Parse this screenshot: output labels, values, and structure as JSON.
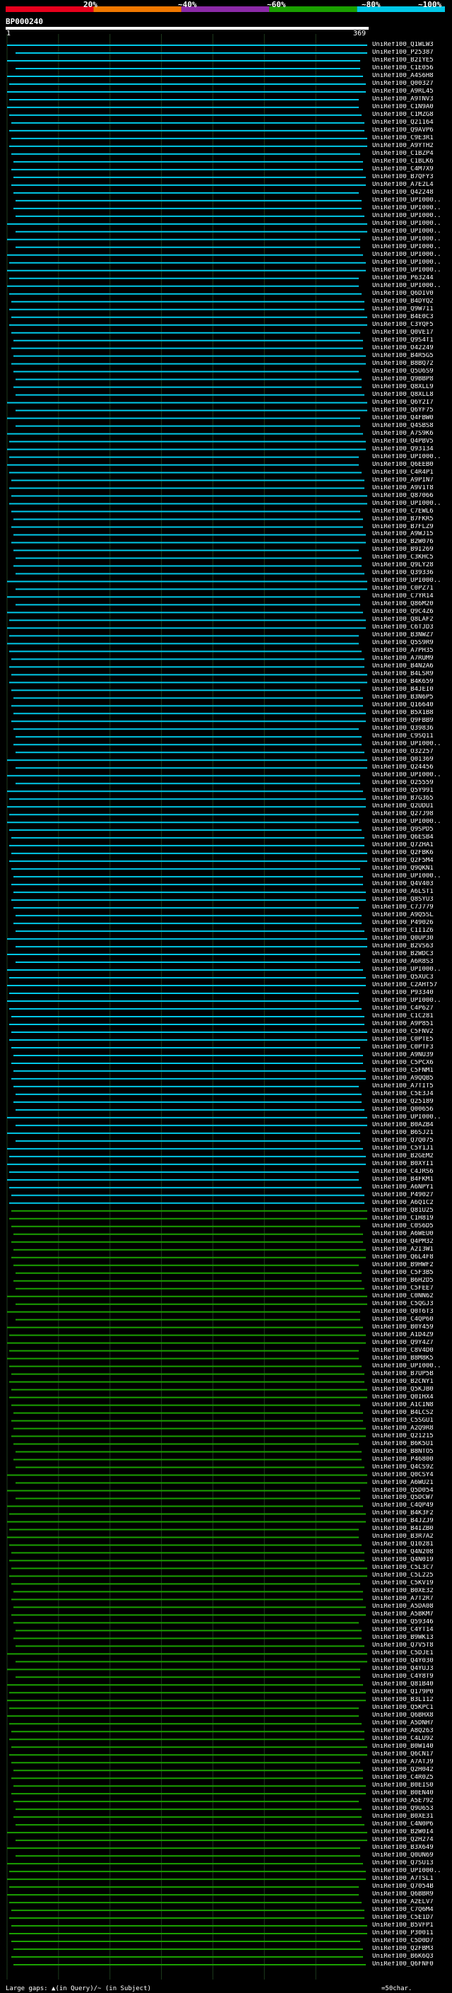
{
  "header": {
    "query_name": "BP000240",
    "ruler_start": "1",
    "ruler_end": "369",
    "color_bands": [
      {
        "label": "20%",
        "color": "#e8001c"
      },
      {
        "label": "40%",
        "color": "#f07800"
      },
      {
        "label": "60%",
        "color": "#8c2aa8"
      },
      {
        "label": "80%",
        "color": "#1aa000"
      },
      {
        "label": "100%",
        "color": "#00c8e8"
      }
    ],
    "band_labels": [
      "20%",
      "~40%",
      "~60%",
      "~80%",
      "~100%"
    ]
  },
  "chart_data": {
    "type": "alignment",
    "query_length": 369,
    "colors": {
      "high": "#00c8e8",
      "mid": "#1aa000"
    },
    "hits": [
      "UniRef100_Q1WLW3",
      "UniRef100_P25387",
      "UniRef100_B2IYE5",
      "UniRef100_C1E056",
      "UniRef100_A4S6H8",
      "UniRef100_Q00327",
      "UniRef100_A9RL45",
      "UniRef100_A9TNV3",
      "UniRef100_C1N9A0",
      "UniRef100_C1MZG8",
      "UniRef100_Q21164",
      "UniRef100_Q9AVP6",
      "UniRef100_C9E3R1",
      "UniRef100_A9YTH2",
      "UniRef100_C1BZP4",
      "UniRef100_C1BLK6",
      "UniRef100_C4M7X9",
      "UniRef100_B7QFY3",
      "UniRef100_A7E2L4",
      "UniRef100_Q42248",
      "UniRef100_UPI000..",
      "UniRef100_UPI000..",
      "UniRef100_UPI000..",
      "UniRef100_UPI000..",
      "UniRef100_UPI000..",
      "UniRef100_UPI000..",
      "UniRef100_UPI000..",
      "UniRef100_UPI000..",
      "UniRef100_UPI000..",
      "UniRef100_UPI000..",
      "UniRef100_P63244",
      "UniRef100_UPI000..",
      "UniRef100_Q6DIV0",
      "UniRef100_B4DYQ2",
      "UniRef100_Q9W711",
      "UniRef100_B4E0C3",
      "UniRef100_C3YQF5",
      "UniRef100_Q0VE17",
      "UniRef100_Q9S4T1",
      "UniRef100_O42249",
      "UniRef100_B4R5G5",
      "UniRef100_B8BQ72",
      "UniRef100_Q5U6S9",
      "UniRef100_Q9BBP8",
      "UniRef100_Q8XLL9",
      "UniRef100_Q8XLL8",
      "UniRef100_Q6Y2I7",
      "UniRef100_Q6YF75",
      "UniRef100_Q4FBW0",
      "UniRef100_Q4SBS8",
      "UniRef100_A7S9K6",
      "UniRef100_Q4PBV5",
      "UniRef100_Q93134",
      "UniRef100_UPI000..",
      "UniRef100_Q6EEB0",
      "UniRef100_C4R4P1",
      "UniRef100_A9PIN7",
      "UniRef100_A9V1T8",
      "UniRef100_Q87066",
      "UniRef100_UPI000..",
      "UniRef100_C7EWL6",
      "UniRef100_B7FKR5",
      "UniRef100_B7FLZ9",
      "UniRef100_A9WJ15",
      "UniRef100_B2W076",
      "UniRef100_B9I269",
      "UniRef100_C3KHC5",
      "UniRef100_Q9LY28",
      "UniRef100_Q39336",
      "UniRef100_UPI000..",
      "UniRef100_C0PZ71",
      "UniRef100_C7YR14",
      "UniRef100_Q86M20",
      "UniRef100_Q9C4Z6",
      "UniRef100_Q8LAF2",
      "UniRef100_C6TJD3",
      "UniRef100_B3NWZ7",
      "UniRef100_Q5S9R9",
      "UniRef100_A7PH35",
      "UniRef100_A7RUM9",
      "UniRef100_B4N2A6",
      "UniRef100_B4LSR9",
      "UniRef100_B4K659",
      "UniRef100_B4JEI0",
      "UniRef100_B3N6P5",
      "UniRef100_Q16640",
      "UniRef100_B5X1B8",
      "UniRef100_Q9FBB9",
      "UniRef100_Q39836",
      "UniRef100_C9SQ11",
      "UniRef100_UPI000..",
      "UniRef100_O32257",
      "UniRef100_Q01369",
      "UniRef100_Q24456",
      "UniRef100_UPI000..",
      "UniRef100_O25559",
      "UniRef100_Q5Y991",
      "UniRef100_B7G365",
      "UniRef100_Q2UDU1",
      "UniRef100_Q27J98",
      "UniRef100_UPI000..",
      "UniRef100_Q9SPD5",
      "UniRef100_Q6ESB4",
      "UniRef100_Q7ZHA1",
      "UniRef100_Q2FBK6",
      "UniRef100_Q2F5M4",
      "UniRef100_Q9QKN1",
      "UniRef100_UPI000..",
      "UniRef100_Q4V403",
      "UniRef100_A6LST1",
      "UniRef100_Q8SYU3",
      "UniRef100_C7J779",
      "UniRef100_A9Q5SL",
      "UniRef100_P49026",
      "UniRef100_C1I1Z6",
      "UniRef100_Q0UP30",
      "UniRef100_B2VS63",
      "UniRef100_B2WDC3",
      "UniRef100_A6R8S3",
      "UniRef100_UPI000..",
      "UniRef100_Q5XUC3",
      "UniRef100_C2AHT57",
      "UniRef100_P93340",
      "UniRef100_UPI000..",
      "UniRef100_C4P627",
      "UniRef100_C1C281",
      "UniRef100_A9P851",
      "UniRef100_C5FNV2",
      "UniRef100_C0PTE5",
      "UniRef100_C0PTF3",
      "UniRef100_A9NU39",
      "UniRef100_C5PCX6",
      "UniRef100_C5FNM1",
      "UniRef100_A9QQB5",
      "UniRef100_A7TIT5",
      "UniRef100_C5E3J4",
      "UniRef100_Q25189",
      "UniRef100_Q00656",
      "UniRef100_UPI000..",
      "UniRef100_B0AZB4",
      "UniRef100_B6SJ21",
      "UniRef100_Q7Q075",
      "UniRef100_C5Y1J1",
      "UniRef100_B2GEM2",
      "UniRef100_B0XYI1",
      "UniRef100_C4JRS6",
      "UniRef100_B4FKM1",
      "UniRef100_A6NPY1",
      "UniRef100_P49027",
      "UniRef100_A6Q1C2",
      "UniRef100_Q81U25",
      "UniRef100_C1H819",
      "UniRef100_C0S6D5",
      "UniRef100_A6WEU0",
      "UniRef100_Q4PM32",
      "UniRef100_A2I3W1",
      "UniRef100_Q6L4F8",
      "UniRef100_B9HWF2",
      "UniRef100_C5F3B5",
      "UniRef100_B6H2D5",
      "UniRef100_C5FEE7",
      "UniRef100_C0NN62",
      "UniRef100_C5QGJ3",
      "UniRef100_Q0T6T3",
      "UniRef100_C4QP60",
      "UniRef100_B0Y459",
      "UniRef100_A1D4Z9",
      "UniRef100_Q9Y4Z7",
      "UniRef100_C8V4D0",
      "UniRef100_B8M8K5",
      "UniRef100_UPI000..",
      "UniRef100_B7UP5B",
      "UniRef100_B2CNY1",
      "UniRef100_Q5KJB0",
      "UniRef100_Q0IHX4",
      "UniRef100_A1CIN8",
      "UniRef100_B4LCS2",
      "UniRef100_C5SGU1",
      "UniRef100_A2Q9R8",
      "UniRef100_Q21215",
      "UniRef100_B6K5U1",
      "UniRef100_B8NTO5",
      "UniRef100_P46800",
      "UniRef100_Q4CS9Z",
      "UniRef100_Q0CSY4",
      "UniRef100_A6WU21",
      "UniRef100_Q5D054",
      "UniRef100_Q5DCW7",
      "UniRef100_C4QP49",
      "UniRef100_B4K3F2",
      "UniRef100_B4JZJ9",
      "UniRef100_B4IZB0",
      "UniRef100_B3R7A2",
      "UniRef100_Q10281",
      "UniRef100_Q4N208",
      "UniRef100_Q4N019",
      "UniRef100_C5L3C7",
      "UniRef100_C5L225",
      "UniRef100_C5KV19",
      "UniRef100_B0XE32",
      "UniRef100_A7T2R7",
      "UniRef100_A5DA08",
      "UniRef100_A5BKM7",
      "UniRef100_Q59346",
      "UniRef100_C4YT14",
      "UniRef100_B9WK13",
      "UniRef100_Q7V5T8",
      "UniRef100_C5DJE1",
      "UniRef100_Q4Y030",
      "UniRef100_Q4YUJ3",
      "UniRef100_C4Y8T9",
      "UniRef100_Q81B40",
      "UniRef100_Q179P0",
      "UniRef100_B3L112",
      "UniRef100_Q5KPC1",
      "UniRef100_Q6BHX8",
      "UniRef100_A5DNH7",
      "UniRef100_A8Q263",
      "UniRef100_C4LU92",
      "UniRef100_B0W140",
      "UniRef100_Q6CN17",
      "UniRef100_A7ATJ9",
      "UniRef100_Q2H042",
      "UniRef100_C4R0Z5",
      "UniRef100_B0EIS0",
      "UniRef100_B0EN40",
      "UniRef100_A5E792",
      "UniRef100_Q9U653",
      "UniRef100_B0XE31",
      "UniRef100_C4N0P6",
      "UniRef100_B2W0I4",
      "UniRef100_Q2H274",
      "UniRef100_B3X649",
      "UniRef100_Q0UN69",
      "UniRef100_Q7SU13",
      "UniRef100_UPI000..",
      "UniRef100_A7TSL1",
      "UniRef100_Q7054B",
      "UniRef100_Q6BBR9",
      "UniRef100_A2ELV7",
      "UniRef100_C7Q6M4",
      "UniRef100_C5E1D7",
      "UniRef100_B5VFP1",
      "UniRef100_P30011",
      "UniRef100_C5D0D7",
      "UniRef100_Q2FBM3",
      "UniRef100_B6K6Q3",
      "UniRef100_Q6FNF0"
    ]
  },
  "footer": {
    "large_gaps_text": "Large gaps: ▲(in Query)/~ (in Subject)",
    "scale_text": "=50char."
  }
}
